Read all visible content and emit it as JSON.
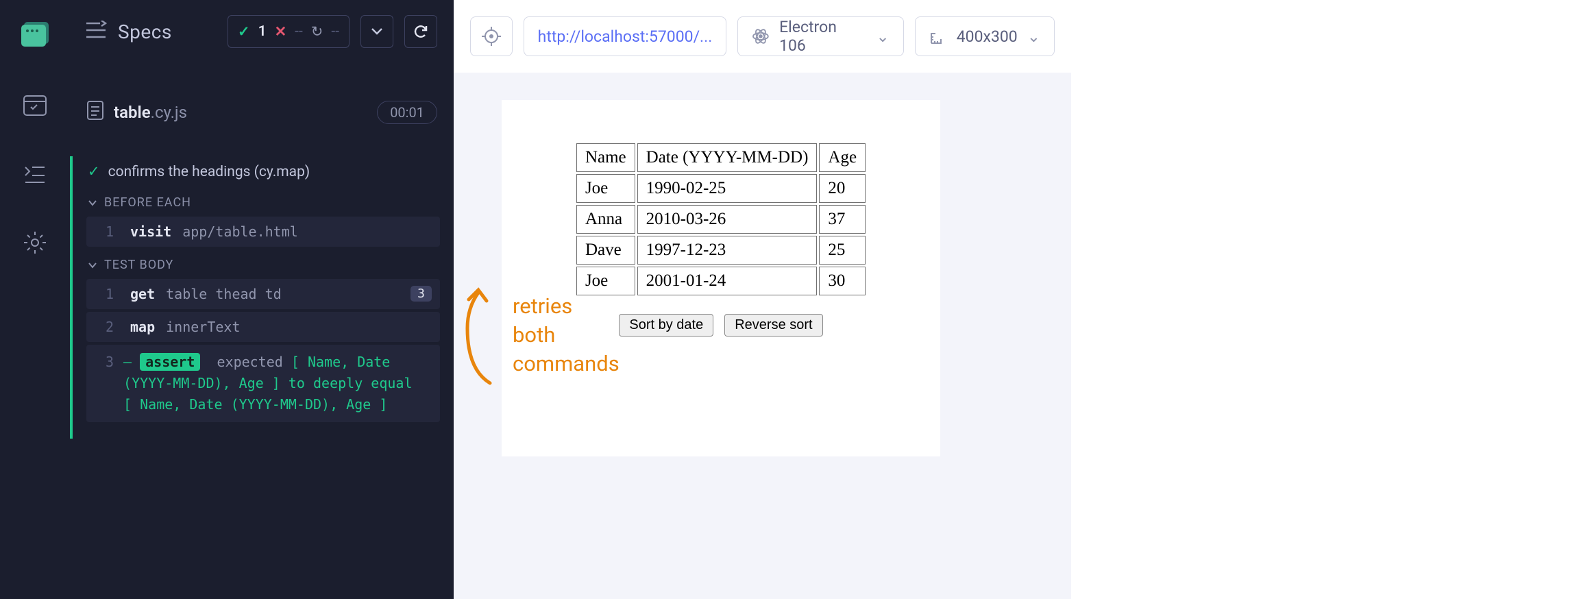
{
  "sidebar": {
    "items": [
      "logo",
      "spec-explorer",
      "runs",
      "settings"
    ]
  },
  "header": {
    "title": "Specs",
    "stats": {
      "passed": 1,
      "failed": "--",
      "pending": "--"
    }
  },
  "specFile": {
    "name": "table",
    "ext": ".cy.js",
    "time": "00:01"
  },
  "test": {
    "title": "confirms the headings (cy.map)",
    "beforeEach": {
      "label": "BEFORE EACH",
      "logs": [
        {
          "n": 1,
          "cmd": "visit",
          "args": "app/table.html"
        }
      ]
    },
    "body": {
      "label": "TEST BODY",
      "logs": [
        {
          "n": 1,
          "cmd": "get",
          "args": "table thead td",
          "badge": "3"
        },
        {
          "n": 2,
          "cmd": "map",
          "args": "innerText"
        },
        {
          "n": 3,
          "cmd": "assert",
          "pre": "expected",
          "val1": "[ Name, Date (YYYY-MM-DD), Age ]",
          "mid": "to deeply equal",
          "val2": "[ Name, Date (YYYY-MM-DD), Age ]"
        }
      ]
    }
  },
  "topbar": {
    "url": "http://localhost:57000/...",
    "browser": "Electron 106",
    "viewport": "400x300"
  },
  "preview": {
    "headers": [
      "Name",
      "Date (YYYY-MM-DD)",
      "Age"
    ],
    "rows": [
      [
        "Joe",
        "1990-02-25",
        "20"
      ],
      [
        "Anna",
        "2010-03-26",
        "37"
      ],
      [
        "Dave",
        "1997-12-23",
        "25"
      ],
      [
        "Joe",
        "2001-01-24",
        "30"
      ]
    ],
    "buttons": [
      "Sort by date",
      "Reverse sort"
    ]
  },
  "annotation": "retries\nboth\ncommands"
}
